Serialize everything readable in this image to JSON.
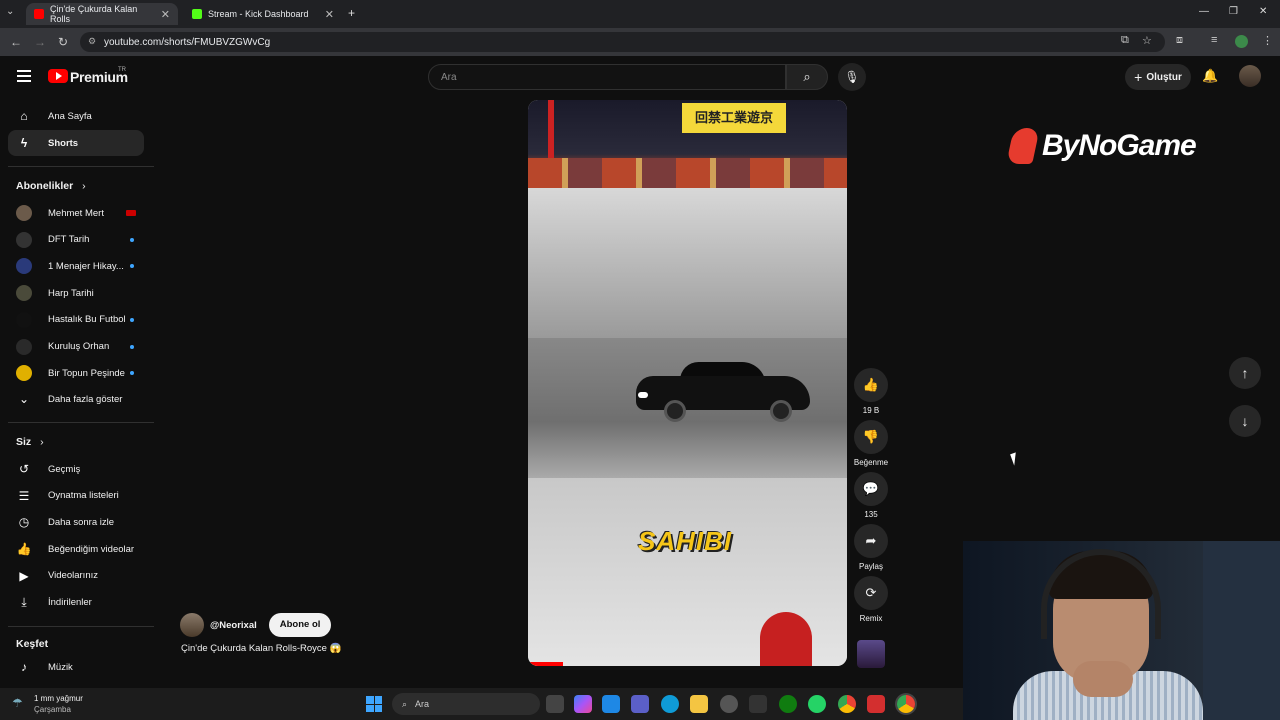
{
  "browser": {
    "tabs": [
      {
        "title": "Çin'de Çukurda Kalan Rolls",
        "active": true,
        "favicon_color": "#ff0000"
      },
      {
        "title": "Stream - Kick Dashboard",
        "active": false,
        "favicon_color": "#53fc18"
      }
    ],
    "url": "youtube.com/shorts/FMUBVZGWvCg"
  },
  "header": {
    "brand": "Premium",
    "region": "TR",
    "search_placeholder": "Ara",
    "create_label": "Oluştur"
  },
  "sidebar": {
    "main": [
      {
        "label": "Ana Sayfa",
        "icon": "home-icon",
        "glyph": "⌂"
      },
      {
        "label": "Shorts",
        "icon": "shorts-icon",
        "glyph": "ϟ",
        "active": true
      }
    ],
    "subscriptions_title": "Abonelikler",
    "subscriptions": [
      {
        "label": "Mehmet Mert",
        "color": "#6b5a4a",
        "indicator": "live"
      },
      {
        "label": "DFT Tarih",
        "color": "#333333",
        "indicator": "dot"
      },
      {
        "label": "1 Menajer Hikay...",
        "color": "#2a3a7a",
        "indicator": "dot"
      },
      {
        "label": "Harp Tarihi",
        "color": "#4a4a3a",
        "indicator": "none"
      },
      {
        "label": "Hastalık Bu Futbol",
        "color": "#111111",
        "indicator": "dot"
      },
      {
        "label": "Kuruluş Orhan",
        "color": "#2a2a2a",
        "indicator": "dot"
      },
      {
        "label": "Bir Topun Peşinde",
        "color": "#e0b000",
        "indicator": "dot"
      }
    ],
    "show_more": "Daha fazla göster",
    "you_title": "Siz",
    "you": [
      {
        "label": "Geçmiş",
        "icon": "history-icon",
        "glyph": "↺"
      },
      {
        "label": "Oynatma listeleri",
        "icon": "playlists-icon",
        "glyph": "☰"
      },
      {
        "label": "Daha sonra izle",
        "icon": "watch-later-icon",
        "glyph": "◷"
      },
      {
        "label": "Beğendiğim videolar",
        "icon": "liked-videos-icon",
        "glyph": "👍"
      },
      {
        "label": "Videolarınız",
        "icon": "your-videos-icon",
        "glyph": "▶"
      },
      {
        "label": "İndirilenler",
        "icon": "downloads-icon",
        "glyph": "⤓"
      }
    ],
    "explore_title": "Keşfet",
    "explore": [
      {
        "label": "Müzik",
        "icon": "music-icon",
        "glyph": "♪"
      }
    ]
  },
  "short": {
    "sign_text": "回禁工業遊京",
    "caption_overlay": "SAHIBI",
    "channel": "@Neorixal",
    "subscribe_label": "Abone ol",
    "title": "Çin'de Çukurda Kalan Rolls-Royce 😱",
    "progress": 0.11
  },
  "actions": [
    {
      "name": "like",
      "icon": "like-icon",
      "glyph": "👍",
      "label": "19 B"
    },
    {
      "name": "dislike",
      "icon": "dislike-icon",
      "glyph": "👎",
      "label": "Beğenme"
    },
    {
      "name": "comments",
      "icon": "comment-icon",
      "glyph": "💬",
      "label": "135"
    },
    {
      "name": "share",
      "icon": "share-icon",
      "glyph": "➦",
      "label": "Paylaş"
    },
    {
      "name": "remix",
      "icon": "remix-icon",
      "glyph": "⟳",
      "label": "Remix"
    }
  ],
  "overlay_brand": "ByNoGame",
  "taskbar": {
    "weather_line1": "1 mm yağmur",
    "weather_line2": "Çarşamba",
    "search_placeholder": "Ara"
  }
}
